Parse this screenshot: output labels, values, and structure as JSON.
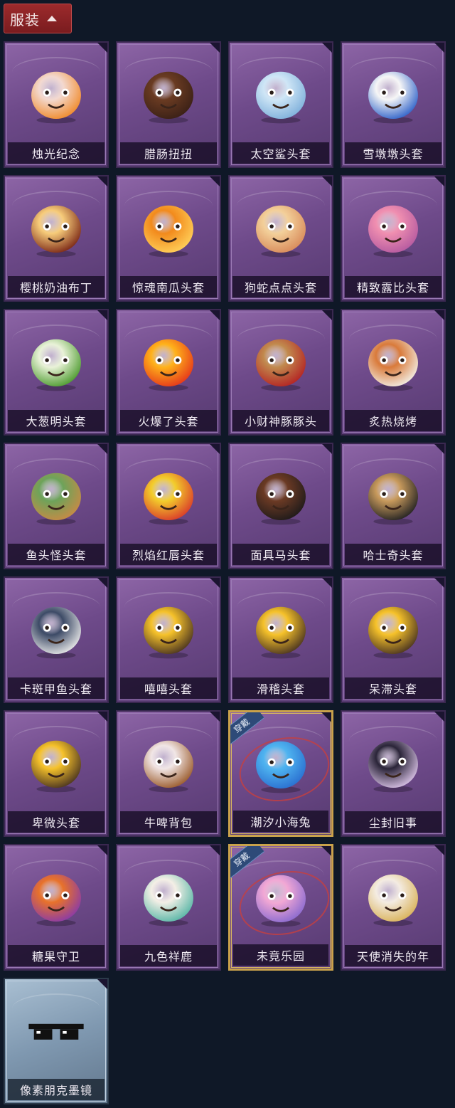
{
  "section": {
    "title": "服装"
  },
  "equipped_badge": "穿戴",
  "items": [
    {
      "label": "烛光纪念",
      "icon": "candle-head-icon",
      "c1": "#f3d9d0",
      "c2": "#f08a2a"
    },
    {
      "label": "腊肠扭扭",
      "icon": "dachshund-head-icon",
      "c1": "#6a3b22",
      "c2": "#3a2016"
    },
    {
      "label": "太空鲨头套",
      "icon": "shark-head-icon",
      "c1": "#cfe6f6",
      "c2": "#7fb0db"
    },
    {
      "label": "雪墩墩头套",
      "icon": "snowman-head-icon",
      "c1": "#f6f6f6",
      "c2": "#2f62c9"
    },
    {
      "label": "樱桃奶油布丁",
      "icon": "pudding-head-icon",
      "c1": "#f7cc7a",
      "c2": "#7a2615"
    },
    {
      "label": "惊魂南瓜头套",
      "icon": "pumpkin-head-icon",
      "c1": "#f28a1c",
      "c2": "#ffd05a"
    },
    {
      "label": "狗蛇点点头套",
      "icon": "snake-head-icon",
      "c1": "#f3d09a",
      "c2": "#d88a5a"
    },
    {
      "label": "精致露比头套",
      "icon": "pink-beaver-head-icon",
      "c1": "#f08fb0",
      "c2": "#b55aa0"
    },
    {
      "label": "大葱明头套",
      "icon": "scallion-head-icon",
      "c1": "#e9f2d8",
      "c2": "#4c9b2e"
    },
    {
      "label": "火爆了头套",
      "icon": "fire-head-icon",
      "c1": "#ffb21a",
      "c2": "#e5361a"
    },
    {
      "label": "小财神豚豚头",
      "icon": "capybara-head-icon",
      "c1": "#c18a4e",
      "c2": "#b42323"
    },
    {
      "label": "炙热烧烤",
      "icon": "roast-meat-head-icon",
      "c1": "#d97a3a",
      "c2": "#f2eee4"
    },
    {
      "label": "鱼头怪头套",
      "icon": "fish-head-icon",
      "c1": "#6da35a",
      "c2": "#c88a45"
    },
    {
      "label": "烈焰红唇头套",
      "icon": "yellow-mask-head-icon",
      "c1": "#f3cd2b",
      "c2": "#d93a2a"
    },
    {
      "label": "面具马头套",
      "icon": "horse-head-icon",
      "c1": "#6b3a24",
      "c2": "#1e1a1a"
    },
    {
      "label": "哈士奇头套",
      "icon": "husky-head-icon",
      "c1": "#c89a5c",
      "c2": "#222222"
    },
    {
      "label": "卡斑甲鱼头套",
      "icon": "whale-head-icon",
      "c1": "#3c4a66",
      "c2": "#e8e8e8"
    },
    {
      "label": "嘻嘻头套",
      "icon": "grin-emoji-head-icon",
      "c1": "#f6c22a",
      "c2": "#4a3420"
    },
    {
      "label": "滑稽头套",
      "icon": "funny-emoji-head-icon",
      "c1": "#f6c22a",
      "c2": "#4a3420"
    },
    {
      "label": "呆滞头套",
      "icon": "dazed-emoji-head-icon",
      "c1": "#f6c22a",
      "c2": "#4a3420"
    },
    {
      "label": "卑微头套",
      "icon": "humble-emoji-head-icon",
      "c1": "#f6c22a",
      "c2": "#4a3420"
    },
    {
      "label": "牛啤背包",
      "icon": "cow-beer-backpack-icon",
      "c1": "#f1e6e6",
      "c2": "#9a5a2a"
    },
    {
      "label": "潮汐小海兔",
      "icon": "sea-bunny-icon",
      "c1": "#4fb4f0",
      "c2": "#2a6fd0",
      "equipped": true
    },
    {
      "label": "尘封旧事",
      "icon": "doll-pendant-icon",
      "c1": "#2a2438",
      "c2": "#d9c2e6"
    },
    {
      "label": "糖果守卫",
      "icon": "pumpkin-pendant-icon",
      "c1": "#e8722a",
      "c2": "#8a3aa8"
    },
    {
      "label": "九色祥鹿",
      "icon": "deer-pendant-icon",
      "c1": "#f4efe6",
      "c2": "#58b6a6"
    },
    {
      "label": "未竟乐园",
      "icon": "girl-pendant-icon",
      "c1": "#f2a8d4",
      "c2": "#8a6ad0",
      "equipped": true
    },
    {
      "label": "天使消失的年",
      "icon": "angel-pendant-icon",
      "c1": "#f4ece2",
      "c2": "#d9b25a"
    },
    {
      "label": "像素朋克墨镜",
      "icon": "pixel-sunglasses-icon",
      "c1": "#111111",
      "c2": "#ffffff",
      "variant": "blue"
    }
  ]
}
